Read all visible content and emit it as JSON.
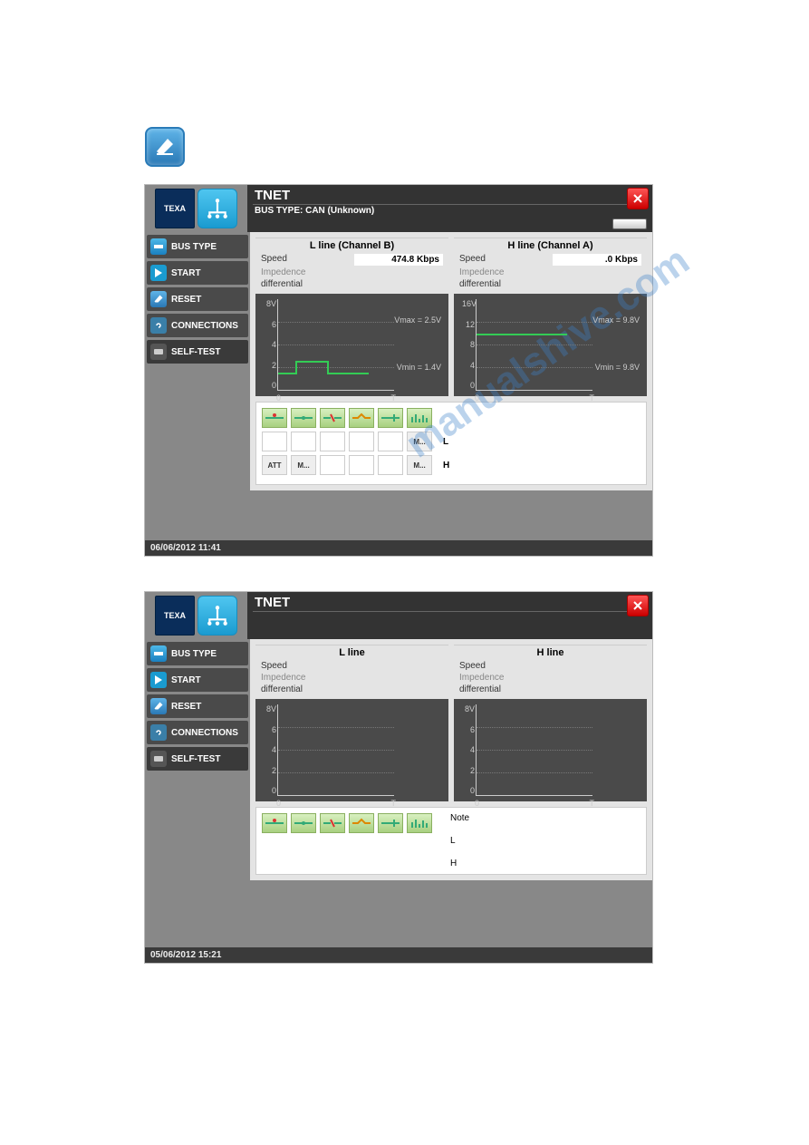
{
  "watermark": "manualshive.com",
  "screenshot1": {
    "header": {
      "title": "TNET",
      "bus_type": "BUS TYPE: CAN (Unknown)"
    },
    "sidebar": {
      "bus_type": "BUS TYPE",
      "start": "START",
      "reset": "RESET",
      "connections": "CONNECTIONS",
      "self_test": "SELF-TEST"
    },
    "channelL": {
      "title": "L line (Channel B)",
      "speed_label": "Speed",
      "speed_value": "474.8 Kbps",
      "impedence_label": "Impedence",
      "differential_label": "differential"
    },
    "channelH": {
      "title": "H line (Channel A)",
      "speed_label": "Speed",
      "speed_value": ".0 Kbps",
      "impedence_label": "Impedence",
      "differential_label": "differential"
    },
    "chart_data": [
      {
        "type": "line",
        "title": "L line (Channel B)",
        "xlabel": "T",
        "ylabel": "V",
        "ylim": [
          0,
          8
        ],
        "yticks": [
          0,
          2,
          4,
          6,
          "8V"
        ],
        "vmax_label": "Vmax = 2.5V",
        "vmin_label": "Vmin = 1.4V",
        "description": "stepped square waveform oscillating between ~1.4V and ~2.5V"
      },
      {
        "type": "line",
        "title": "H line (Channel A)",
        "xlabel": "T",
        "ylabel": "V",
        "ylim": [
          0,
          16
        ],
        "yticks": [
          0,
          4,
          8,
          12,
          "16V"
        ],
        "vmax_label": "Vmax = 9.8V",
        "vmin_label": "Vmin = 9.8V",
        "description": "flat line at ~9.8V"
      }
    ],
    "status": {
      "row2": {
        "c5": "M...",
        "label": "L"
      },
      "row3": {
        "c1": "ATT",
        "c2": "M...",
        "c5": "M...",
        "label": "H"
      }
    },
    "footer_datetime": "06/06/2012  11:41"
  },
  "screenshot2": {
    "header": {
      "title": "TNET",
      "bus_type": ""
    },
    "sidebar": {
      "bus_type": "BUS TYPE",
      "start": "START",
      "reset": "RESET",
      "connections": "CONNECTIONS",
      "self_test": "SELF-TEST"
    },
    "channelL": {
      "title": "L line",
      "speed_label": "Speed",
      "impedence_label": "Impedence",
      "differential_label": "differential"
    },
    "channelH": {
      "title": "H line",
      "speed_label": "Speed",
      "impedence_label": "Impedence",
      "differential_label": "differential"
    },
    "chart_data": [
      {
        "type": "line",
        "title": "L line",
        "xlabel": "T",
        "ylabel": "V",
        "ylim": [
          0,
          8
        ],
        "yticks": [
          0,
          2,
          4,
          6,
          "8V"
        ],
        "description": "empty chart (no trace)"
      },
      {
        "type": "line",
        "title": "H line",
        "xlabel": "T",
        "ylabel": "V",
        "ylim": [
          0,
          8
        ],
        "yticks": [
          0,
          2,
          4,
          6,
          "8V"
        ],
        "description": "empty chart (no trace)"
      }
    ],
    "status": {
      "note_label": "Note",
      "l_label": "L",
      "h_label": "H"
    },
    "footer_datetime": "05/06/2012  15:21"
  },
  "brand": {
    "texa": "TEXA"
  }
}
